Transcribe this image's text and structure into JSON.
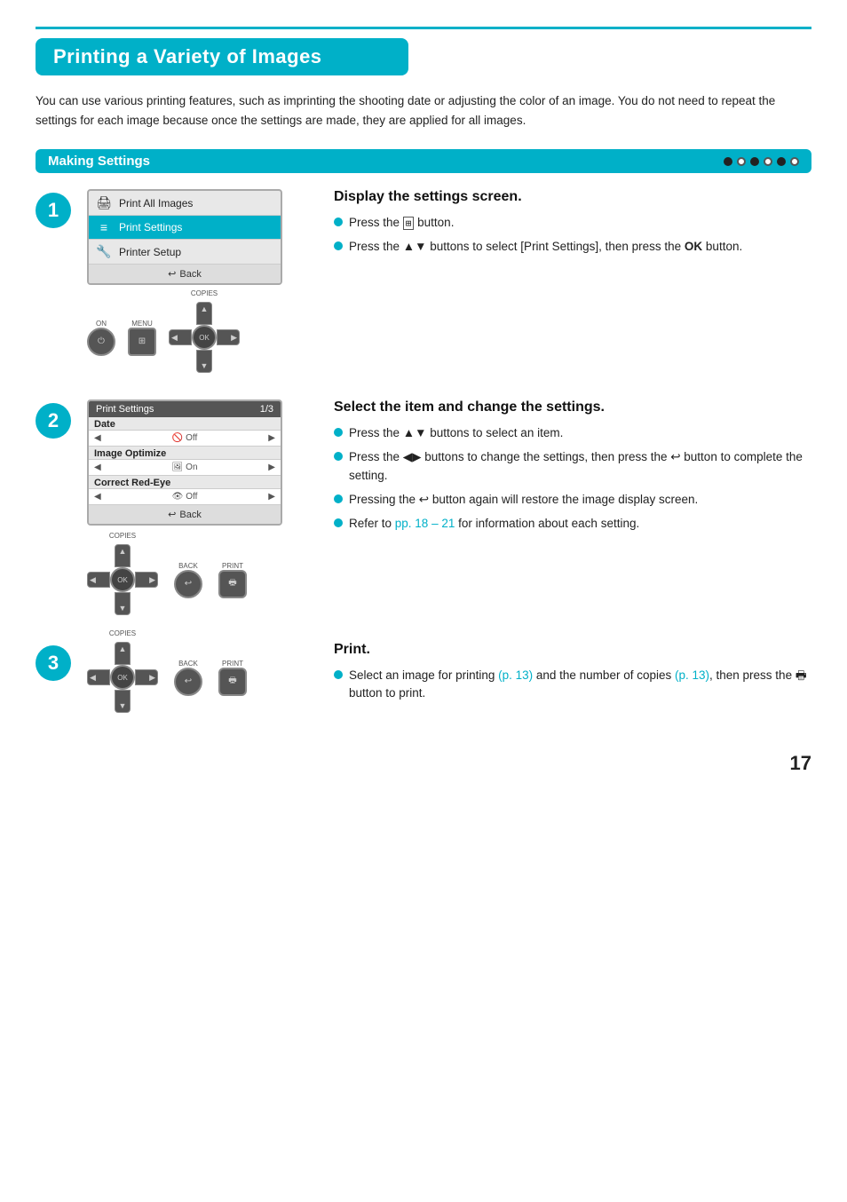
{
  "page": {
    "title": "Printing a Variety of Images",
    "intro": "You can use various printing features, such as imprinting the shooting date or adjusting the color of an image. You do not need to repeat the settings for each image because once the settings are made, they are applied for all images.",
    "section": {
      "title": "Making Settings",
      "dots": [
        "filled",
        "outline",
        "filled",
        "outline",
        "filled",
        "outline"
      ]
    },
    "step1": {
      "number": "1",
      "heading": "Display the settings screen.",
      "bullets": [
        "Press the  button.",
        "Press the ▲▼ buttons to select [Print Settings], then press the OK button."
      ],
      "screen": {
        "items": [
          {
            "icon": "🖨",
            "label": "Print All Images",
            "selected": false
          },
          {
            "icon": "≡",
            "label": "Print Settings",
            "selected": true
          },
          {
            "icon": "🔧",
            "label": "Printer Setup",
            "selected": false
          }
        ],
        "back_label": "Back"
      }
    },
    "step2": {
      "number": "2",
      "heading": "Select the item and change the settings.",
      "bullets": [
        "Press the ▲▼ buttons to select an item.",
        "Press the ◀▶ buttons to change the settings, then press the  button to complete the setting.",
        "Pressing the  button again will restore the image display screen.",
        "Refer to pp. 18 – 21 for information about each setting."
      ],
      "screen": {
        "title": "Print Settings",
        "page": "1/3",
        "rows": [
          {
            "section": "Date",
            "value": "Off",
            "icon": "🚫"
          },
          {
            "section": "Image Optimize",
            "value": "On",
            "icon": "🖼"
          },
          {
            "section": "Correct Red-Eye",
            "value": "Off",
            "icon": "👁"
          }
        ],
        "back_label": "Back"
      }
    },
    "step3": {
      "number": "3",
      "heading": "Print.",
      "bullets": [
        "Select an image for printing (p. 13) and the number of copies (p. 13), then press the  button to print."
      ]
    },
    "labels": {
      "copies": "COPIES",
      "on": "ON",
      "menu": "MENU",
      "back": "BACK",
      "print": "PRINT",
      "ok": "OK",
      "page_number": "17"
    }
  }
}
